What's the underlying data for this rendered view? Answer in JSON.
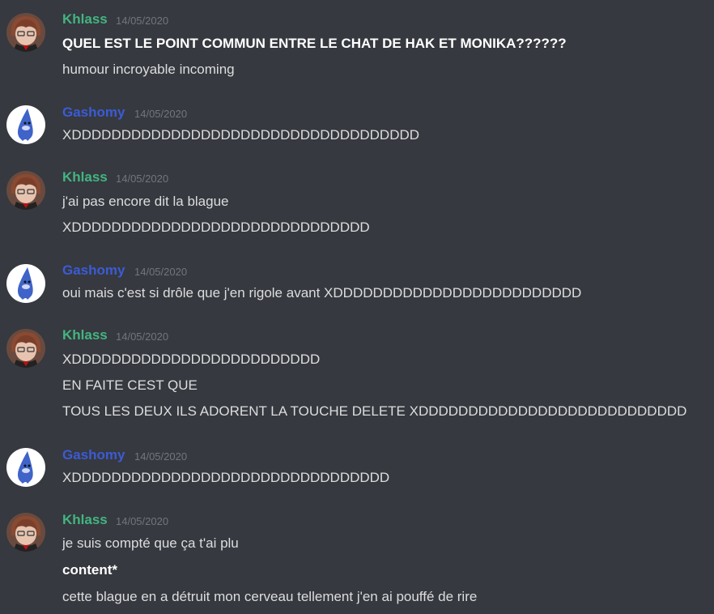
{
  "colors": {
    "background": "#36393f",
    "khlass": "#43b581",
    "gashomy": "#3c5bd6",
    "timestamp": "#72767d",
    "text": "#dcddde"
  },
  "messages": [
    {
      "author": "Khlass",
      "timestamp": "14/05/2020",
      "avatar": "khlass-avatar",
      "lines": [
        "QUEL EST LE POINT COMMUN ENTRE LE CHAT DE HAK ET MONIKA??????",
        "humour incroyable incoming"
      ]
    },
    {
      "author": "Gashomy",
      "timestamp": "14/05/2020",
      "avatar": "gashomy-avatar",
      "lines": [
        "XDDDDDDDDDDDDDDDDDDDDDDDDDDDDDDDDDDD"
      ]
    },
    {
      "author": "Khlass",
      "timestamp": "14/05/2020",
      "avatar": "khlass-avatar",
      "lines": [
        "j'ai pas encore dit la blague",
        "XDDDDDDDDDDDDDDDDDDDDDDDDDDDDDD"
      ]
    },
    {
      "author": "Gashomy",
      "timestamp": "14/05/2020",
      "avatar": "gashomy-avatar",
      "lines": [
        "oui mais c'est si drôle que j'en rigole avant XDDDDDDDDDDDDDDDDDDDDDDDDD"
      ]
    },
    {
      "author": "Khlass",
      "timestamp": "14/05/2020",
      "avatar": "khlass-avatar",
      "lines": [
        "XDDDDDDDDDDDDDDDDDDDDDDDDD",
        "EN FAITE CEST QUE",
        "TOUS LES DEUX ILS ADORENT LA TOUCHE DELETE XDDDDDDDDDDDDDDDDDDDDDDDDDDD"
      ]
    },
    {
      "author": "Gashomy",
      "timestamp": "14/05/2020",
      "avatar": "gashomy-avatar",
      "lines": [
        "XDDDDDDDDDDDDDDDDDDDDDDDDDDDDDDDD"
      ]
    },
    {
      "author": "Khlass",
      "timestamp": "14/05/2020",
      "avatar": "khlass-avatar",
      "lines": [
        "je suis compté que ça t'ai plu",
        "content*",
        "cette blague en a détruit mon cerveau tellement j'en ai pouffé de rire"
      ]
    }
  ]
}
